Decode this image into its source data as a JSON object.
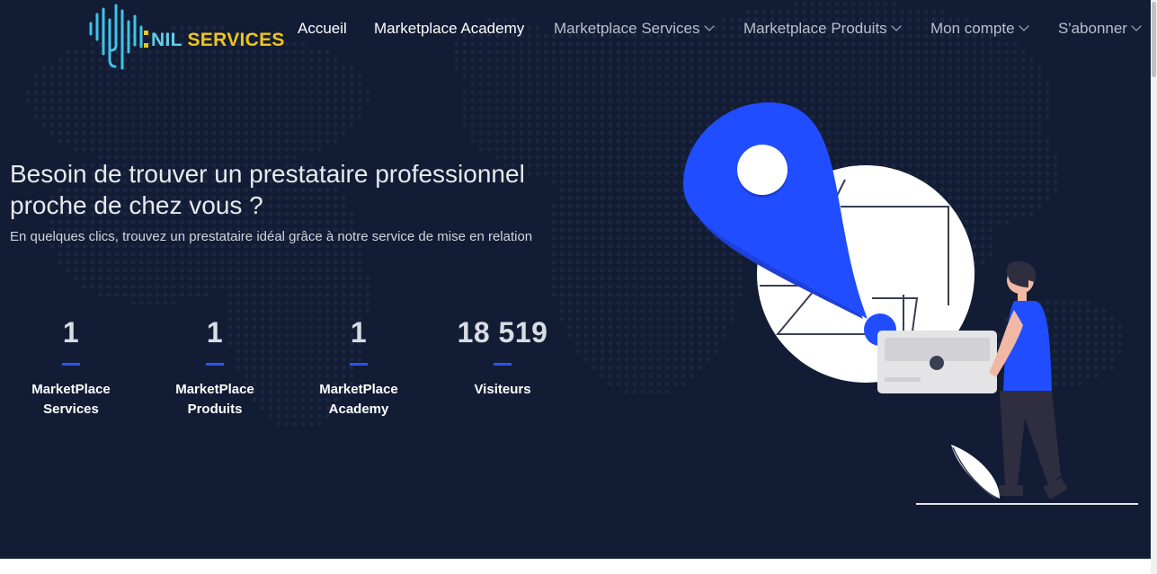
{
  "brand": {
    "name_part1": "NIL",
    "name_part2": "SERVICES"
  },
  "nav": {
    "accueil": "Accueil",
    "academy": "Marketplace Academy",
    "services": "Marketplace Services",
    "produits": "Marketplace Produits",
    "compte": "Mon compte",
    "abonner": "S'abonner"
  },
  "hero": {
    "title": "Besoin de trouver un prestataire professionnel proche de chez vous ?",
    "subtitle": "En quelques clics, trouvez un prestataire idéal grâce à notre service de mise en relation"
  },
  "stats": [
    {
      "value": "1",
      "label_line1": "MarketPlace",
      "label_line2": "Services"
    },
    {
      "value": "1",
      "label_line1": "MarketPlace",
      "label_line2": "Produits"
    },
    {
      "value": "1",
      "label_line1": "MarketPlace",
      "label_line2": "Academy"
    },
    {
      "value": "18 519",
      "label_line1": "Visiteurs",
      "label_line2": ""
    }
  ],
  "colors": {
    "background": "#131c35",
    "accent_blue": "#2f54eb",
    "logo_cyan": "#5fd0e8",
    "logo_yellow": "#f0c419"
  },
  "icons": {
    "dropdown": "chevron-down-icon",
    "logo": "sound-wave-logo-icon"
  }
}
